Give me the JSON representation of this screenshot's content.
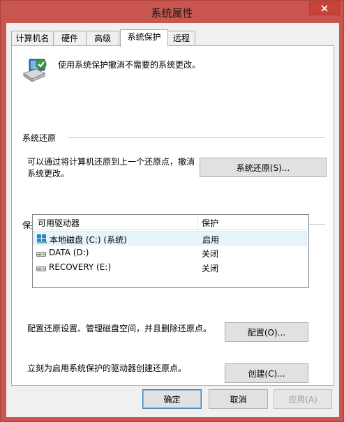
{
  "window": {
    "title": "系统属性",
    "close_icon": "close-icon"
  },
  "tabs": [
    {
      "label": "计算机名",
      "active": false
    },
    {
      "label": "硬件",
      "active": false
    },
    {
      "label": "高级",
      "active": false
    },
    {
      "label": "系统保护",
      "active": true
    },
    {
      "label": "远程",
      "active": false
    }
  ],
  "intro": {
    "icon": "system-protection-icon",
    "text": "使用系统保护撤消不需要的系统更改。"
  },
  "restore": {
    "group_label": "系统还原",
    "description_line1": "可以通过将计算机还原到上一个还原点，撤消",
    "description_line2": "系统更改。",
    "button_label": "系统还原(S)..."
  },
  "protection": {
    "group_label": "保护设置",
    "columns": [
      "可用驱动器",
      "保护"
    ],
    "drives": [
      {
        "name": "本地磁盘 (C:) (系统)",
        "status": "启用",
        "icon": "windows-drive-icon",
        "selected": true
      },
      {
        "name": "DATA (D:)",
        "status": "关闭",
        "icon": "drive-icon",
        "selected": false
      },
      {
        "name": "RECOVERY (E:)",
        "status": "关闭",
        "icon": "drive-icon",
        "selected": false
      }
    ],
    "configure_text": "配置还原设置、管理磁盘空间，并且删除还原点。",
    "configure_button": "配置(O)...",
    "create_text": "立刻为启用系统保护的驱动器创建还原点。",
    "create_button": "创建(C)..."
  },
  "footer": {
    "ok": "确定",
    "cancel": "取消",
    "apply": "应用(A)"
  },
  "colors": {
    "frame": "#c9564e",
    "close_button": "#c74238",
    "selection": "#e5f3fb",
    "default_button_border": "#3c7fb1"
  }
}
